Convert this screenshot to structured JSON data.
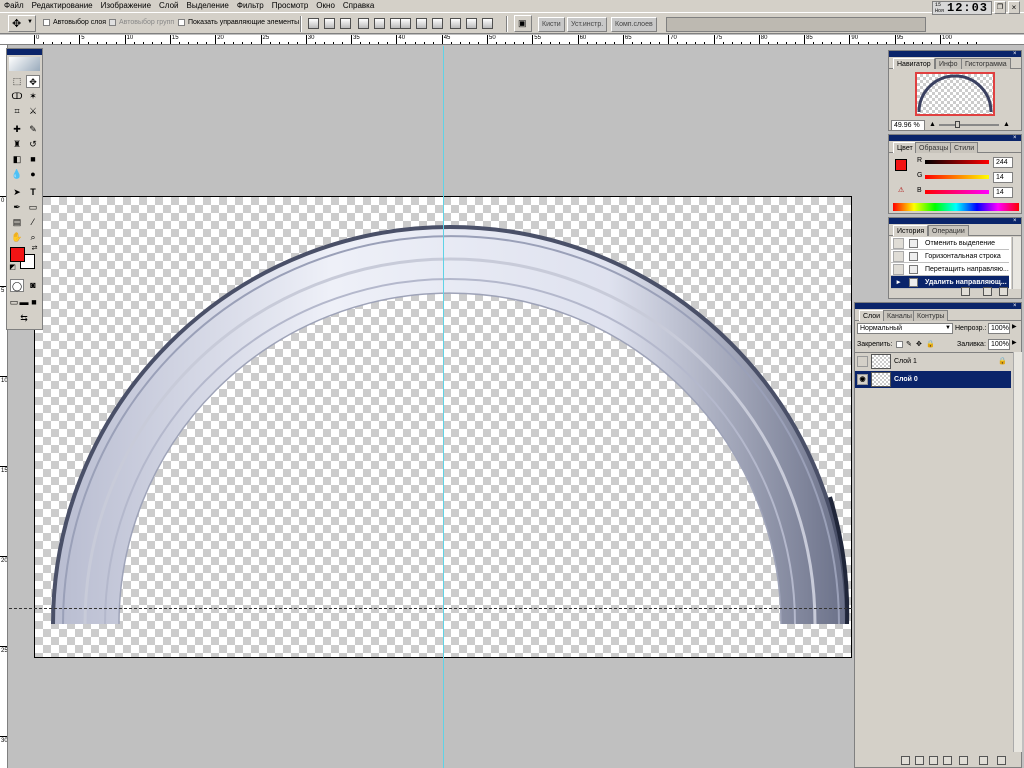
{
  "menu": [
    "Файл",
    "Редактирование",
    "Изображение",
    "Слой",
    "Выделение",
    "Фильтр",
    "Просмотр",
    "Окно",
    "Справка"
  ],
  "options": {
    "auto_select_layer": "Автовыбор слоя",
    "auto_select_groups": "Автовыбор групп",
    "show_controls": "Показать управляющие элементы"
  },
  "well_tabs": [
    "Кисти",
    "Уст.инстр.",
    "Комп.слоев"
  ],
  "clock": {
    "day": "15",
    "month": "Ноя",
    "time": "12:03"
  },
  "ruler": {
    "top": [
      "0",
      "5",
      "10",
      "15",
      "20",
      "25",
      "30",
      "35",
      "40",
      "45",
      "50",
      "55",
      "60",
      "65",
      "70",
      "75",
      "80",
      "85",
      "90",
      "95",
      "100"
    ],
    "left": [
      "0",
      "5",
      "10",
      "15",
      "20",
      "25",
      "30"
    ]
  },
  "navigator": {
    "tabs": [
      "Навигатор",
      "Инфо",
      "Гистограмма"
    ],
    "zoom": "49.96 %"
  },
  "color": {
    "tabs": [
      "Цвет",
      "Образцы",
      "Стили"
    ],
    "r_label": "R",
    "g_label": "G",
    "b_label": "B",
    "r": "244",
    "g": "14",
    "b": "14",
    "foreground": "#f21414"
  },
  "history": {
    "tabs": [
      "История",
      "Операции"
    ],
    "items": [
      "Отменить выделение",
      "Горизонтальная строка",
      "Перетащить направляю...",
      "Удалить направляющ..."
    ]
  },
  "layers": {
    "tabs": [
      "Слои",
      "Каналы",
      "Контуры"
    ],
    "blend_mode": "Нормальный",
    "opacity_label": "Непрозр.:",
    "opacity": "100%",
    "lock_label": "Закрепить:",
    "fill_label": "Заливка:",
    "fill": "100%",
    "items": [
      {
        "name": "Слой 1"
      },
      {
        "name": "Слой 0"
      }
    ]
  },
  "colors": {
    "title_bar": "#0a246a",
    "guide": "#5fd3e6",
    "panel_bg": "#d4d0c8",
    "canvas_bg": "#c0c0c0"
  }
}
